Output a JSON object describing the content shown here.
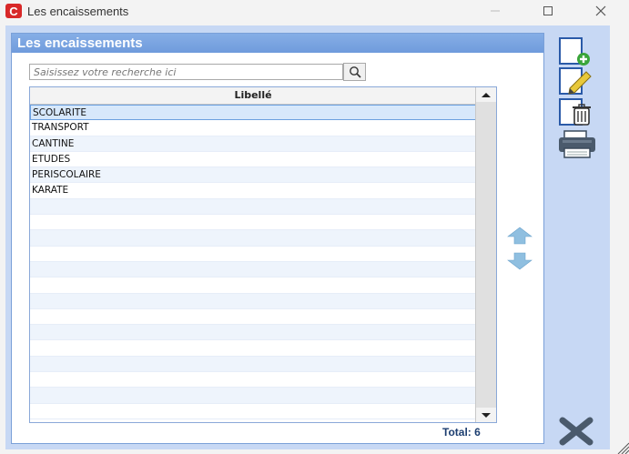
{
  "window": {
    "title": "Les encaissements",
    "minimize_icon": "minimize-icon",
    "maximize_icon": "maximize-icon",
    "close_icon": "close-icon"
  },
  "panel": {
    "title": "Les encaissements"
  },
  "search": {
    "placeholder": "Saisissez votre recherche ici",
    "icon": "search-icon"
  },
  "grid": {
    "column_header": "Libellé",
    "rows": [
      "SCOLARITE",
      "TRANSPORT",
      "CANTINE",
      "ETUDES",
      "PERISCOLAIRE",
      "KARATE"
    ],
    "selected_index": 0,
    "empty_rows": 14
  },
  "footer": {
    "total_label": "Total: 6"
  },
  "toolbar": {
    "add_icon": "add-document-icon",
    "edit_icon": "edit-pencil-icon",
    "delete_icon": "delete-trash-icon",
    "print_icon": "printer-icon",
    "close_icon": "close-x-icon"
  },
  "colors": {
    "accent": "#6f9bdc",
    "panel_bg": "#c7d8f4",
    "selection": "#d7e8fb",
    "total_text": "#1c3e70"
  }
}
